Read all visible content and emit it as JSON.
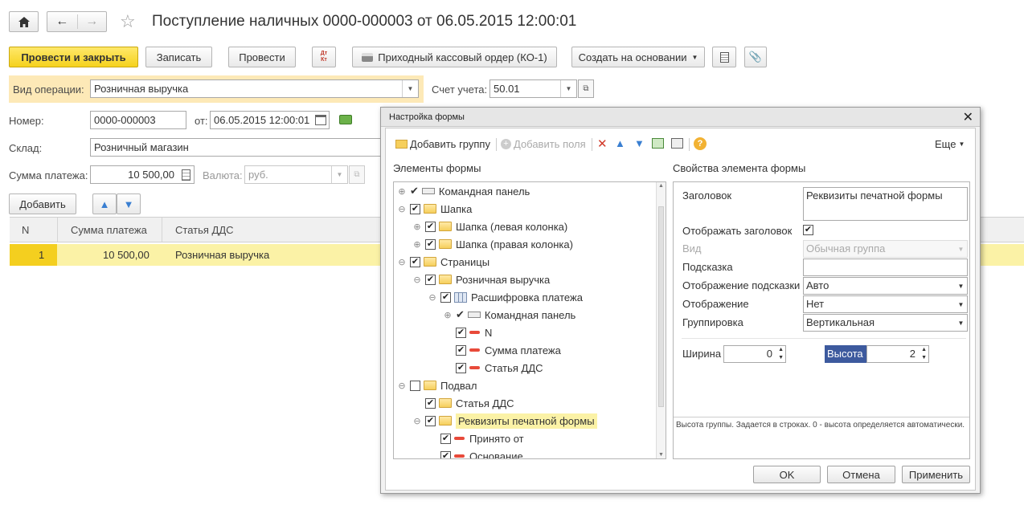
{
  "window": {
    "title": "Поступление наличных 0000-000003 от 06.05.2015 12:00:01"
  },
  "toolbar": {
    "post_close": "Провести и закрыть",
    "save": "Записать",
    "post": "Провести",
    "dt_kt": "Дт Кт",
    "print_order": "Приходный кассовый ордер (КО-1)",
    "create_based": "Создать на основании"
  },
  "form": {
    "op_label": "Вид операции:",
    "op_value": "Розничная выручка",
    "account_label": "Счет учета:",
    "account_value": "50.01",
    "number_label": "Номер:",
    "number_value": "0000-000003",
    "date_label": "от:",
    "date_value": "06.05.2015 12:00:01",
    "warehouse_label": "Склад:",
    "warehouse_value": "Розничный магазин",
    "sum_label": "Сумма платежа:",
    "sum_value": "10 500,00",
    "currency_label": "Валюта:",
    "currency_value": "руб.",
    "add_button": "Добавить"
  },
  "grid": {
    "columns": [
      "N",
      "Сумма платежа",
      "Статья ДДС"
    ],
    "rows": [
      {
        "n": "1",
        "sum": "10 500,00",
        "article": "Розничная выручка"
      }
    ]
  },
  "dialog": {
    "title": "Настройка формы",
    "add_group": "Добавить группу",
    "add_fields": "Добавить поля",
    "more": "Еще",
    "elements_title": "Элементы формы",
    "props_title": "Свойства элемента формы",
    "tree": [
      {
        "label": "Командная панель"
      },
      {
        "label": "Шапка"
      },
      {
        "label": "Шапка (левая колонка)"
      },
      {
        "label": "Шапка (правая колонка)"
      },
      {
        "label": "Страницы"
      },
      {
        "label": "Розничная выручка"
      },
      {
        "label": "Расшифровка платежа"
      },
      {
        "label": "Командная панель"
      },
      {
        "label": "N"
      },
      {
        "label": "Сумма платежа"
      },
      {
        "label": "Статья ДДС"
      },
      {
        "label": "Подвал"
      },
      {
        "label": "Статья ДДС"
      },
      {
        "label": "Реквизиты печатной формы"
      },
      {
        "label": "Принято от"
      },
      {
        "label": "Основание"
      }
    ],
    "props": {
      "heading_label": "Заголовок",
      "heading_value": "Реквизиты печатной формы",
      "show_heading_label": "Отображать заголовок",
      "view_label": "Вид",
      "view_value": "Обычная группа",
      "hint_label": "Подсказка",
      "hint_value": "",
      "hint_display_label": "Отображение подсказки",
      "hint_display_value": "Авто",
      "display_label": "Отображение",
      "display_value": "Нет",
      "grouping_label": "Группировка",
      "grouping_value": "Вертикальная",
      "width_label": "Ширина",
      "width_value": "0",
      "height_label": "Высота",
      "height_value": "2",
      "help_text": "Высота группы. Задается в строках. 0 - высота определяется автоматически."
    },
    "ok": "OK",
    "cancel": "Отмена",
    "apply": "Применить"
  }
}
